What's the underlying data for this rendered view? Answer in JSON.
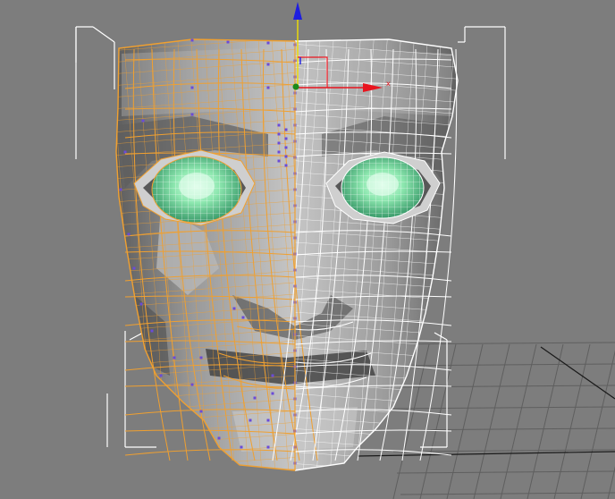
{
  "viewport": {
    "background": "#7d7d7d",
    "grid_color": "#5f5f5f",
    "grid_dark_color": "#1a1a1a",
    "selection_bracket_color": "#ffffff"
  },
  "gizmo": {
    "x_axis_label": "x",
    "x_axis_color": "#e8141e",
    "y_axis_color": "#f0e000",
    "z_axis_color": "#1e1ee0",
    "pivot_color": "#1a8a1a"
  },
  "mesh": {
    "selected_half_color": "#f0a030",
    "selected_vertex_color": "#6a4bd8",
    "unselected_half_color": "#ffffff",
    "shade_light": "#c4c4c4",
    "shade_dark": "#4e4e4e",
    "eye_color": "#8ee8b0",
    "eye_icon": "eyeball-sphere-icon"
  }
}
